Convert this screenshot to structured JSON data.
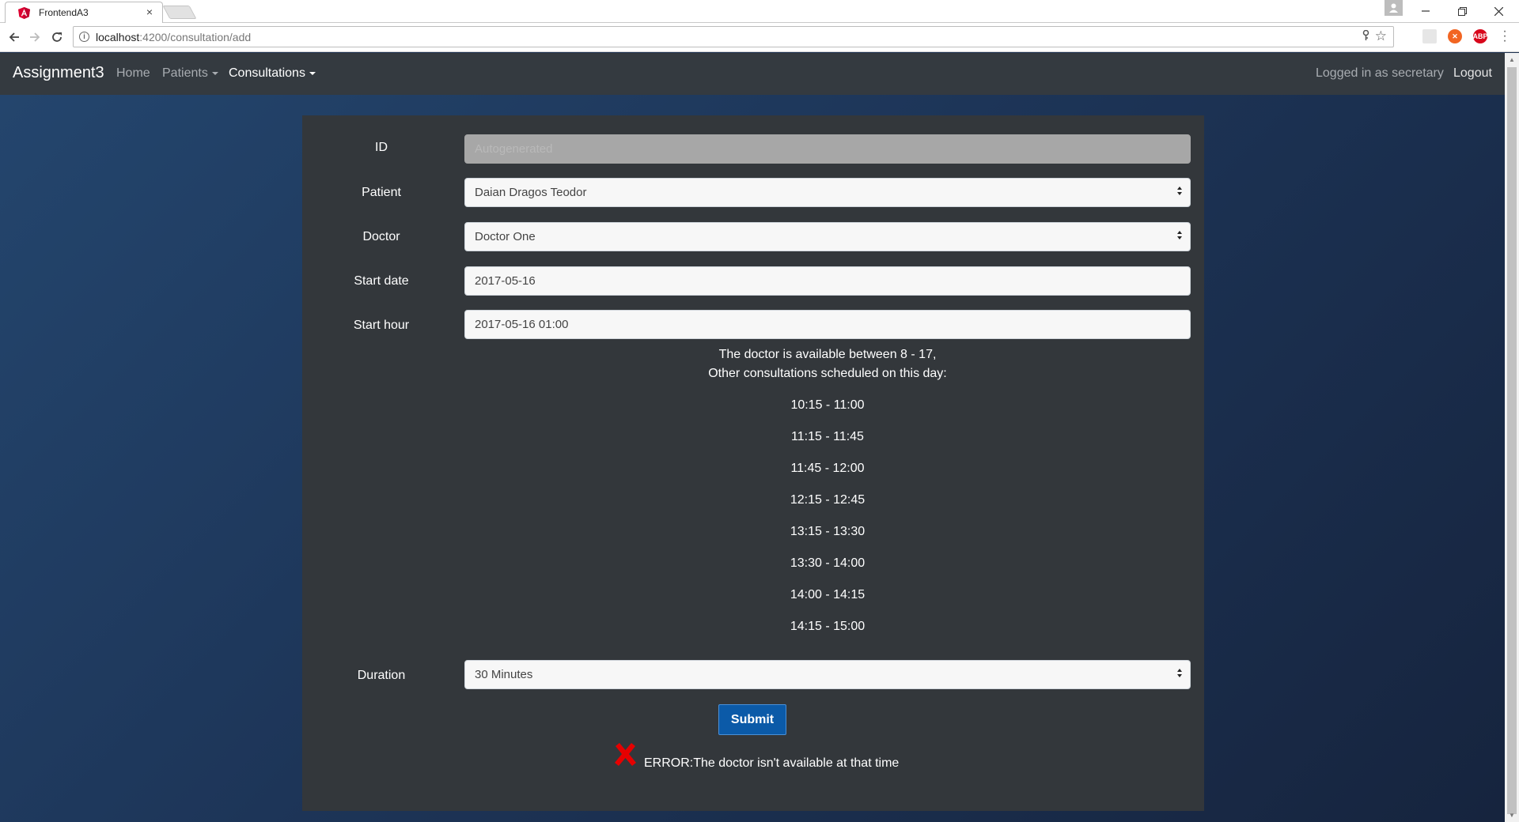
{
  "browser": {
    "tab_title": "FrontendA3",
    "tab_close": "×",
    "url_host": "localhost",
    "url_path": ":4200/consultation/add",
    "ext_abp_label": "ABP"
  },
  "navbar": {
    "brand": "Assignment3",
    "home": "Home",
    "patients": "Patients",
    "consultations": "Consultations",
    "logged_in": "Logged in as secretary",
    "logout": "Logout"
  },
  "form": {
    "id_label": "ID",
    "id_placeholder": "Autogenerated",
    "patient_label": "Patient",
    "patient_value": "Daian Dragos Teodor",
    "doctor_label": "Doctor",
    "doctor_value": "Doctor One",
    "start_date_label": "Start date",
    "start_date_value": "2017-05-16",
    "start_hour_label": "Start hour",
    "start_hour_value": "2017-05-16 01:00",
    "availability_line1": "The doctor is available between 8 - 17,",
    "availability_line2": "Other consultations scheduled on this day:",
    "slots": [
      "10:15 - 11:00",
      "11:15 - 11:45",
      "11:45 - 12:00",
      "12:15 - 12:45",
      "13:15 - 13:30",
      "13:30 - 14:00",
      "14:00 - 14:15",
      "14:15 - 15:00"
    ],
    "duration_label": "Duration",
    "duration_value": "30 Minutes",
    "submit_label": "Submit",
    "error_text": "ERROR:The doctor isn't available at that time"
  },
  "colors": {
    "navbar_bg": "#343a40",
    "card_bg": "#33373b",
    "submit_bg": "#0b5aa8",
    "error_icon": "#e60000"
  },
  "icons": [
    "angular-favicon",
    "back-arrow-icon",
    "forward-arrow-icon",
    "reload-icon",
    "info-icon",
    "key-icon",
    "star-icon",
    "close-icon",
    "error-x-icon"
  ]
}
